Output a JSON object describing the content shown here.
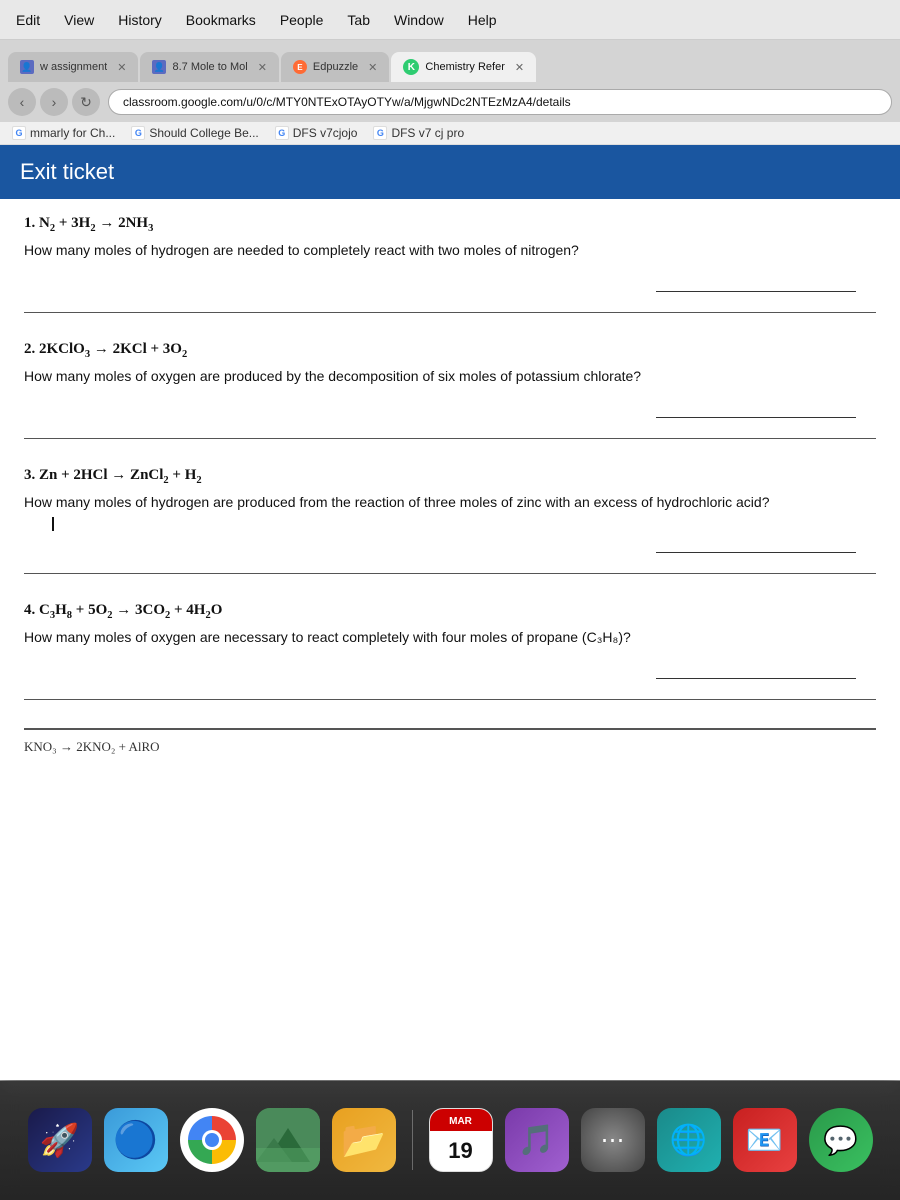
{
  "menubar": {
    "items": [
      "Edit",
      "View",
      "History",
      "Bookmarks",
      "People",
      "Tab",
      "Window",
      "Help"
    ]
  },
  "tabs": [
    {
      "id": "tab1",
      "label": "w assignment",
      "active": false,
      "favicon": "person"
    },
    {
      "id": "tab2",
      "label": "8.7 Mole to Mol",
      "active": false,
      "favicon": "person"
    },
    {
      "id": "tab3",
      "label": "Edpuzzle",
      "active": false,
      "favicon": "edpuzzle"
    },
    {
      "id": "tab4",
      "label": "Chemistry Refer",
      "active": true,
      "favicon": "k"
    }
  ],
  "address_bar": {
    "url": "classroom.google.com/u/0/c/MTY0NTExOTAyOTYw/a/MjgwNDc2NTEzMzA4/details"
  },
  "bookmarks": [
    {
      "label": "mmarly for Ch...",
      "icon": "g"
    },
    {
      "label": "Should College Be...",
      "icon": "g"
    },
    {
      "label": "DFS v7cjojo",
      "icon": "g"
    },
    {
      "label": "DFS v7 cj pro",
      "icon": "g"
    }
  ],
  "exit_ticket": {
    "title": "Exit ticket",
    "questions": [
      {
        "number": "1.",
        "equation": "N₂ + 3H₂ → 2NH₃",
        "text": "How many moles of hydrogen are needed to completely react with two moles of nitrogen?"
      },
      {
        "number": "2.",
        "equation": "2KClO₃ → 2KCl + 3O₂",
        "text": "How many moles of oxygen are produced by the decomposition of six moles of potassium chlorate?"
      },
      {
        "number": "3.",
        "equation": "Zn + 2HCl → ZnCl₂ + H₂",
        "text": "How many moles of hydrogen are produced from the reaction of three moles of zinc with an excess of hydrochloric acid?"
      },
      {
        "number": "4.",
        "equation": "C₃H₈ + 5O₂ → 3CO₂ + 4H₂O",
        "text": "How many moles of oxygen are necessary to react completely with four moles of propane (C₃H₈)?"
      }
    ],
    "partial_equation": "KNO₃ → 2KNO₂ + AlRO"
  },
  "dock": {
    "date_month": "MAR",
    "date_day": "19"
  }
}
